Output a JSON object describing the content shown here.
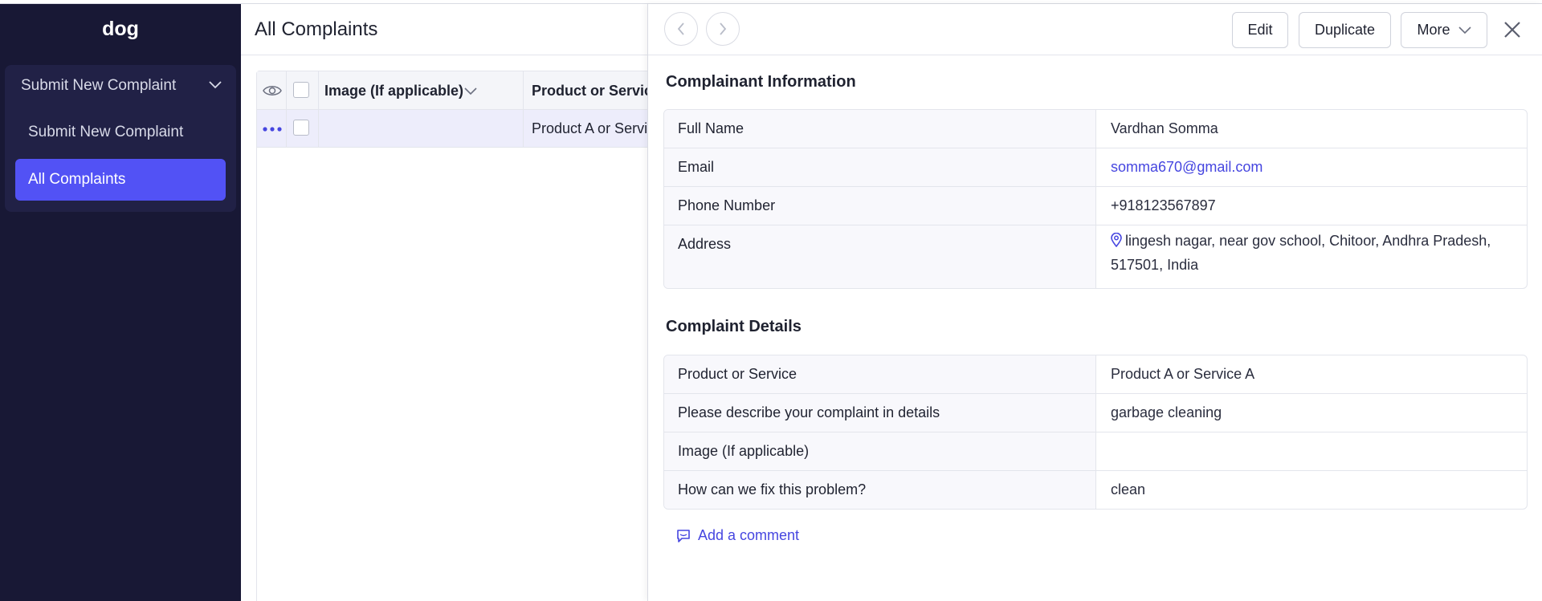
{
  "app": {
    "title": "dog"
  },
  "sidebar": {
    "group_label": "Submit New Complaint",
    "items": [
      {
        "label": "Submit New Complaint"
      },
      {
        "label": "All Complaints"
      }
    ]
  },
  "main": {
    "title": "All Complaints",
    "columns": [
      "Image (If applicable)",
      "Product or Service"
    ],
    "rows": [
      {
        "product": "Product A or Service A"
      }
    ]
  },
  "panel": {
    "toolbar": {
      "edit": "Edit",
      "duplicate": "Duplicate",
      "more": "More"
    },
    "section1": {
      "title": "Complainant Information",
      "rows": [
        {
          "label": "Full Name",
          "value": "Vardhan Somma"
        },
        {
          "label": "Email",
          "value": "somma670@gmail.com"
        },
        {
          "label": "Phone Number",
          "value": "+918123567897"
        },
        {
          "label": "Address",
          "value": "lingesh nagar, near gov school, Chitoor, Andhra Pradesh, 517501, India"
        }
      ]
    },
    "section2": {
      "title": "Complaint Details",
      "rows": [
        {
          "label": "Product or Service",
          "value": "Product A or Service A"
        },
        {
          "label": "Please describe your complaint in details",
          "value": "garbage cleaning"
        },
        {
          "label": "Image (If applicable)",
          "value": ""
        },
        {
          "label": "How can we fix this problem?",
          "value": "clean"
        }
      ]
    },
    "comment_label": "Add a comment"
  },
  "colors": {
    "sidebar": "#181835",
    "accent": "#5252f5",
    "link": "#4646e0"
  }
}
